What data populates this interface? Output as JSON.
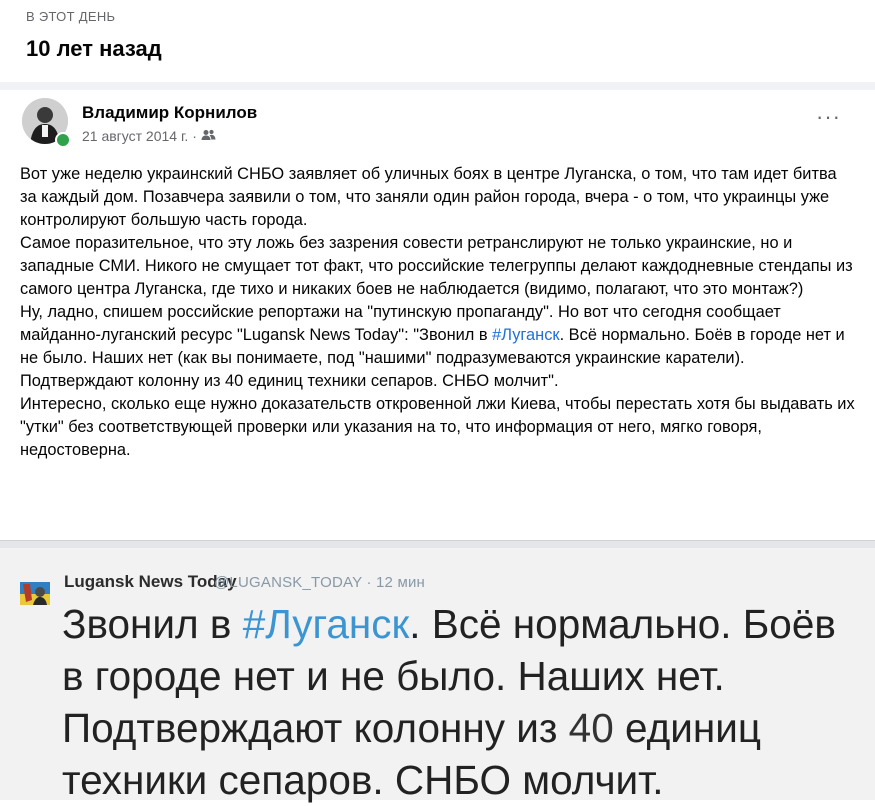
{
  "memory": {
    "label": "В ЭТОТ ДЕНЬ",
    "title": "10 лет назад"
  },
  "post": {
    "author": "Владимир Корнилов",
    "date": "21 август 2014 г.",
    "meta_separator": "·",
    "audience_icon": "friends-icon",
    "more_label": "···",
    "paragraphs": [
      "Вот уже неделю украинский СНБО заявляет об уличных боях в центре Луганска, о том, что там идет битва за каждый дом. Позавчера заявили о том, что заняли один район города, вчера - о том, что украинцы уже контролируют большую часть города.",
      "Самое поразительное, что эту ложь без зазрения совести ретранслируют не только украинские, но и западные СМИ. Никого не смущает тот факт, что российские телегруппы делают каждодневные стендапы из самого центра Луганска, где тихо и никаких боев не наблюдается (видимо, полагают, что это монтаж?)"
    ],
    "p3_before_tag": "Ну, ладно, спишем российские репортажи на \"путинскую пропаганду\". Но вот что сегодня сообщает майданно-луганский ресурс \"Lugansk News Today\": \"Звонил в ",
    "p3_hashtag": "#Луганск",
    "p3_after_tag": ". Всё нормально. Боёв в городе нет и не было. Наших нет (как вы понимаете, под \"нашими\" подразумеваются украинские каратели). Подтверждают колонну из 40 единиц техники сепаров. СНБО молчит\".",
    "p4": "Интересно, сколько еще нужно доказательств откровенной лжи Киева, чтобы перестать хотя бы выдавать их \"утки\" без соответствующей проверки или указания на то, что информация от него, мягко говоря, недостоверна."
  },
  "tweet": {
    "name": "Lugansk News Today",
    "handle": "@LUGANSK_TODAY · 12 мин",
    "text_before_tag": "Звонил в ",
    "hashtag": "#Луганск",
    "text_middle": ". Всё нормально. Боёв в городе нет и не было. Наших нет. Подтверждают колонну из ",
    "number": "40",
    "text_after_number": " единиц техники сепаров. СНБО молчит."
  },
  "colors": {
    "hashtag": "#216fdb",
    "secondary_text": "#65676b",
    "online": "#31a24c"
  }
}
